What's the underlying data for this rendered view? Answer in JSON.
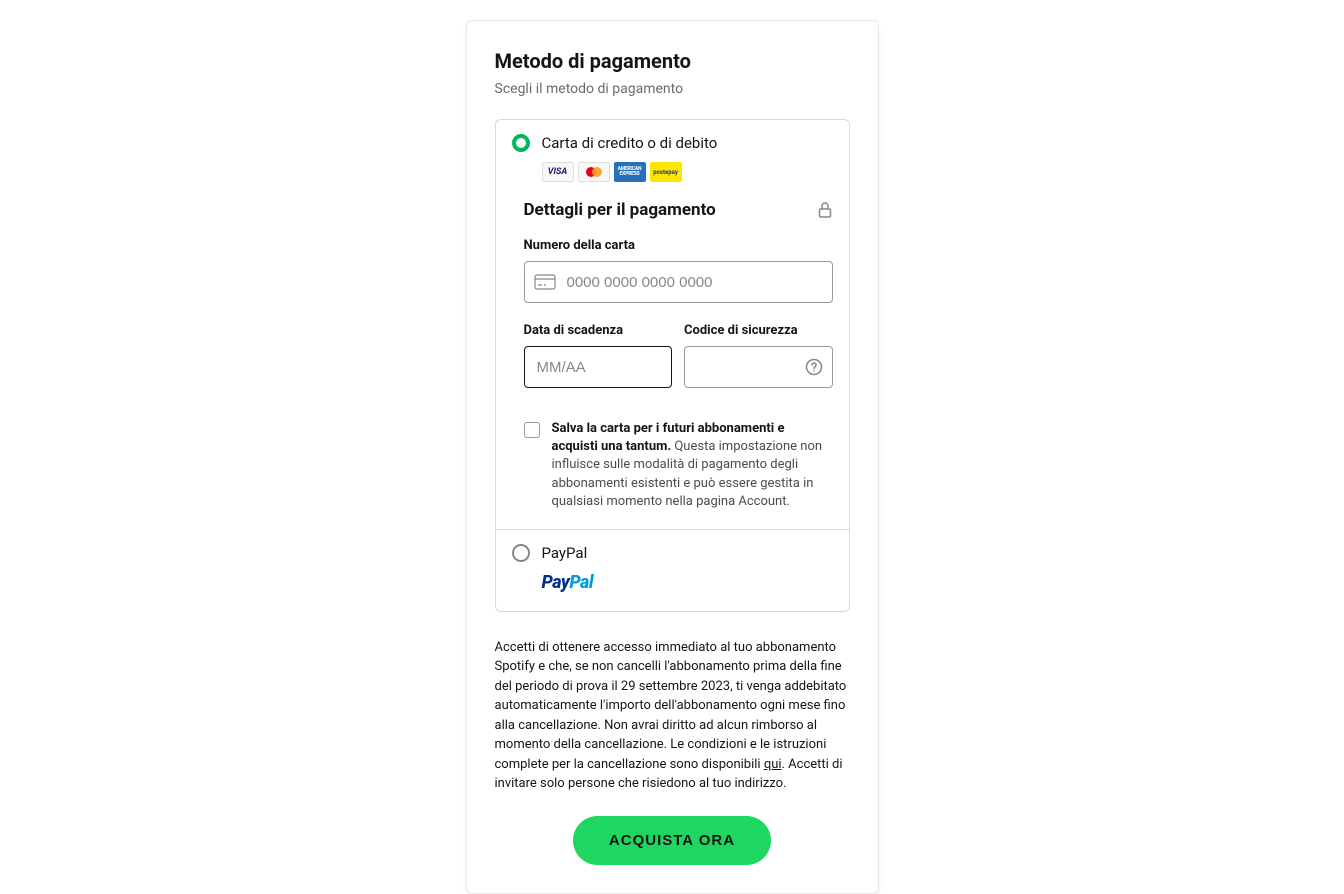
{
  "header": {
    "title": "Metodo di pagamento",
    "subtitle": "Scegli il metodo di pagamento"
  },
  "methods": {
    "card": {
      "label": "Carta di credito o di debito",
      "selected": true,
      "logos": [
        "VISA",
        "mastercard",
        "AMERICAN EXPRESS",
        "postepay"
      ]
    },
    "paypal": {
      "label": "PayPal",
      "selected": false,
      "logo_text_1": "Pay",
      "logo_text_2": "Pal"
    }
  },
  "details": {
    "title": "Dettagli per il pagamento",
    "card_number": {
      "label": "Numero della carta",
      "placeholder": "0000 0000 0000 0000",
      "value": ""
    },
    "expiry": {
      "label": "Data di scadenza",
      "placeholder": "MM/AA",
      "value": ""
    },
    "cvc": {
      "label": "Codice di sicurezza",
      "placeholder": "",
      "value": ""
    },
    "save_card": {
      "bold": "Salva la carta per i futuri abbonamenti e acquisti una tantum.",
      "rest": " Questa impostazione non influisce sulle modalità di pagamento degli abbonamenti esistenti e può essere gestita in qualsiasi momento nella pagina Account.",
      "checked": false
    }
  },
  "terms": {
    "text_before": "Accetti di ottenere accesso immediato al tuo abbonamento Spotify e che, se non cancelli l'abbonamento prima della fine del periodo di prova il 29 settembre 2023, ti venga addebitato automaticamente l'importo dell'abbonamento ogni mese fino alla cancellazione. Non avrai diritto ad alcun rimborso al momento della cancellazione. Le condizioni e le istruzioni complete per la cancellazione sono disponibili ",
    "link": "qui",
    "text_after": ". Accetti di invitare solo persone che risiedono al tuo indirizzo."
  },
  "cta": {
    "label": "ACQUISTA ORA"
  }
}
